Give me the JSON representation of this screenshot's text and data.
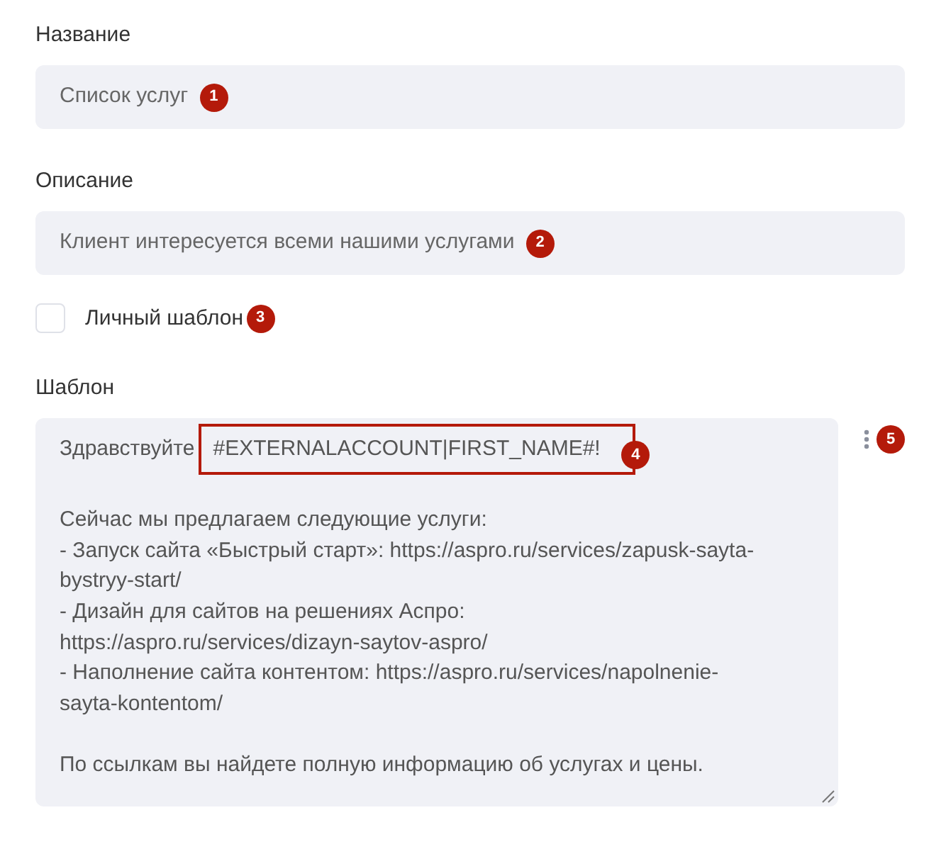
{
  "fields": [
    {
      "label": "Название",
      "value": "Список услуг",
      "marker": "1"
    },
    {
      "label": "Описание",
      "value": "Клиент интересуется всеми нашими услугами",
      "marker": "2"
    }
  ],
  "personal_template": {
    "label": "Личный шаблон",
    "checked": false,
    "marker": "3"
  },
  "template": {
    "label": "Шаблон",
    "greeting": "Здравствуйте",
    "variable": "#EXTERNALACCOUNT|FIRST_NAME#!",
    "variable_marker": "4",
    "menu_marker": "5",
    "paragraphs": [
      [
        "Сейчас мы предлагаем следующие услуги:",
        "- Запуск сайта «Быстрый старт»: https://aspro.ru/services/zapusk-sayta-",
        "bystryy-start/",
        "- Дизайн для сайтов на решениях Аспро:",
        "https://aspro.ru/services/dizayn-saytov-aspro/",
        "- Наполнение сайта контентом: https://aspro.ru/services/napolnenie-",
        "sayta-kontentom/"
      ],
      [
        "По ссылкам вы найдете полную информацию об услугах и цены."
      ]
    ]
  }
}
